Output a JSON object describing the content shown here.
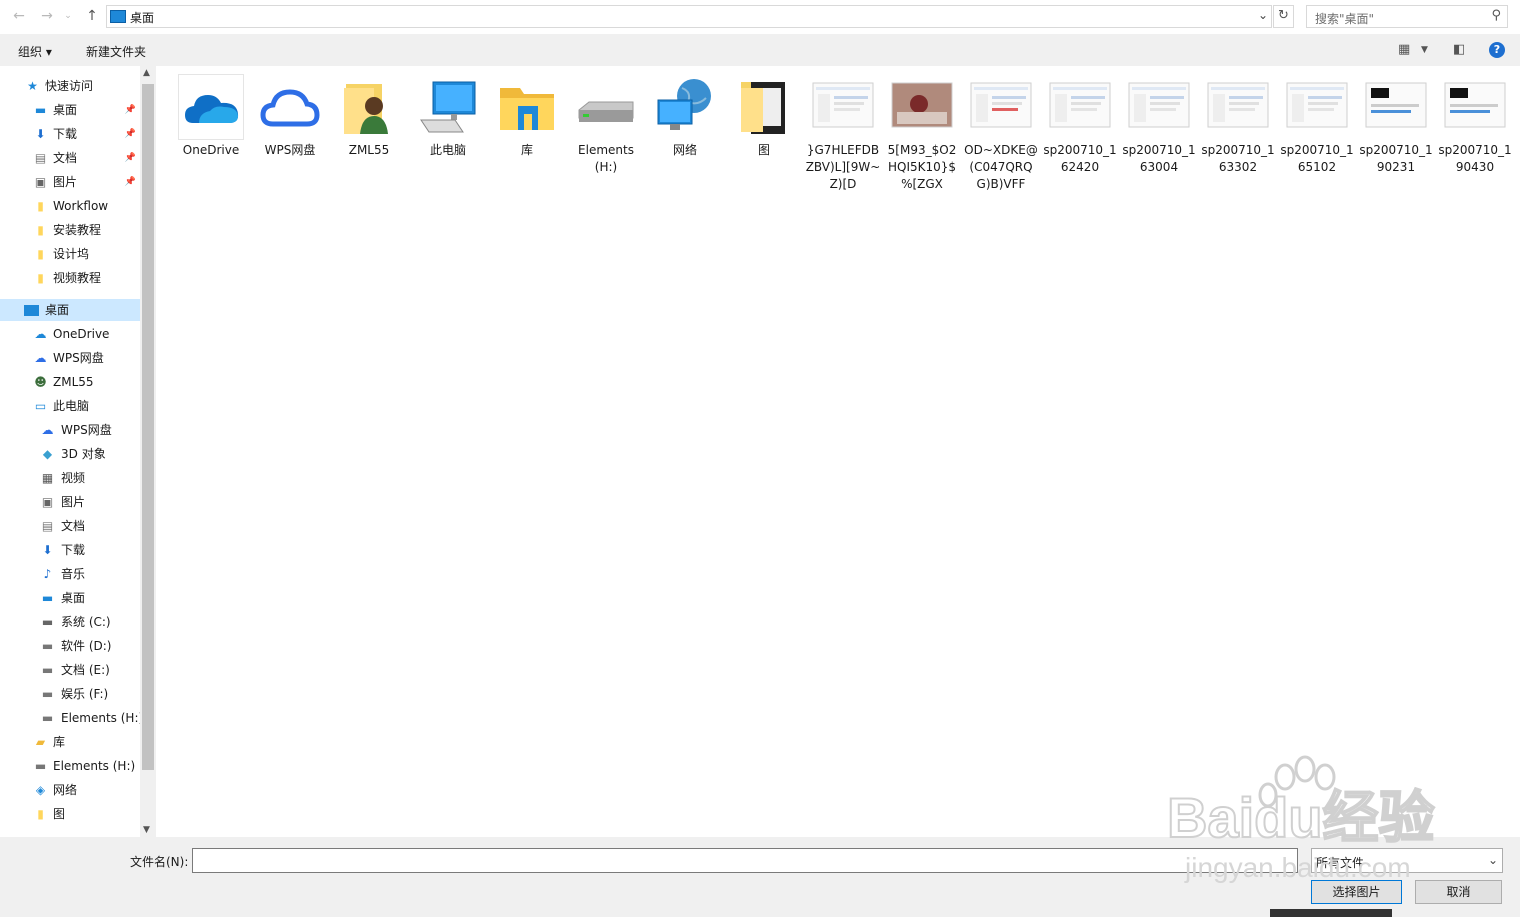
{
  "address": {
    "location": "桌面"
  },
  "search": {
    "placeholder": "搜索\"桌面\""
  },
  "toolbar": {
    "organize": "组织 ▾",
    "new_folder": "新建文件夹"
  },
  "sidebar": {
    "quick_access": "快速访问",
    "quick_items": [
      {
        "label": "桌面",
        "icon": "desktop-icon"
      },
      {
        "label": "下载",
        "icon": "download-icon"
      },
      {
        "label": "文档",
        "icon": "document-icon"
      },
      {
        "label": "图片",
        "icon": "picture-icon"
      },
      {
        "label": "Workflow",
        "icon": "folder-icon"
      },
      {
        "label": "安装教程",
        "icon": "folder-icon"
      },
      {
        "label": "设计坞",
        "icon": "folder-icon"
      },
      {
        "label": "视频教程",
        "icon": "folder-icon"
      }
    ],
    "desktop": "桌面",
    "desktop_items": [
      {
        "label": "OneDrive"
      },
      {
        "label": "WPS网盘"
      },
      {
        "label": "ZML55"
      },
      {
        "label": "此电脑"
      }
    ],
    "pc_items": [
      {
        "label": "WPS网盘"
      },
      {
        "label": "3D 对象"
      },
      {
        "label": "视频"
      },
      {
        "label": "图片"
      },
      {
        "label": "文档"
      },
      {
        "label": "下载"
      },
      {
        "label": "音乐"
      },
      {
        "label": "桌面"
      },
      {
        "label": "系统 (C:)"
      },
      {
        "label": "软件 (D:)"
      },
      {
        "label": "文档 (E:)"
      },
      {
        "label": "娱乐 (F:)"
      },
      {
        "label": "Elements (H:)"
      }
    ],
    "tail_items": [
      {
        "label": "库"
      },
      {
        "label": "Elements (H:)"
      },
      {
        "label": "网络"
      },
      {
        "label": "图"
      }
    ]
  },
  "files": [
    {
      "name": "OneDrive",
      "icon": "onedrive-cloud-icon"
    },
    {
      "name": "WPS网盘",
      "icon": "wps-cloud-icon"
    },
    {
      "name": "ZML55",
      "icon": "user-folder-icon"
    },
    {
      "name": "此电脑",
      "icon": "computer-icon"
    },
    {
      "name": "库",
      "icon": "library-icon"
    },
    {
      "name": "Elements (H:)",
      "icon": "drive-icon"
    },
    {
      "name": "网络",
      "icon": "network-icon"
    },
    {
      "name": "图",
      "icon": "folder-icon"
    },
    {
      "name": "}G7HLEFDBZBV)L][9W~Z)[D",
      "icon": "image-thumbnail-icon"
    },
    {
      "name": "5[M93_$O2HQI5K10}$%[ZGX",
      "icon": "image-thumbnail-icon"
    },
    {
      "name": "OD~XDKE@(C047QRQG)B)VFF",
      "icon": "image-thumbnail-icon"
    },
    {
      "name": "sp200710_162420",
      "icon": "image-thumbnail-icon"
    },
    {
      "name": "sp200710_163004",
      "icon": "image-thumbnail-icon"
    },
    {
      "name": "sp200710_163302",
      "icon": "image-thumbnail-icon"
    },
    {
      "name": "sp200710_165102",
      "icon": "image-thumbnail-icon"
    },
    {
      "name": "sp200710_190231",
      "icon": "image-thumbnail-icon"
    },
    {
      "name": "sp200710_190430",
      "icon": "image-thumbnail-icon"
    }
  ],
  "bottom": {
    "filename_label": "文件名(N):",
    "filename_value": "",
    "filetype_value": "所有文件",
    "open_button": "选择图片",
    "cancel_button": "取消"
  },
  "watermark": {
    "text": "Baidu经验",
    "subtext": "jingyan.baidu.com"
  },
  "colors": {
    "accent": "#0078d7",
    "selection": "#cce8ff",
    "folder": "#ffd65c"
  }
}
